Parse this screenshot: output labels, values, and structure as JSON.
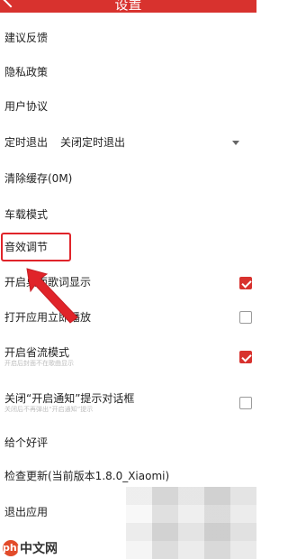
{
  "header": {
    "title": "设置"
  },
  "items": [
    {
      "label": "建议反馈"
    },
    {
      "label": "隐私政策"
    },
    {
      "label": "用户协议"
    },
    {
      "label": "定时退出",
      "value": "关闭定时退出"
    },
    {
      "label": "清除缓存(0M)"
    },
    {
      "label": "车载模式"
    },
    {
      "label": "音效调节"
    },
    {
      "label": "开启桌面歌词显示",
      "checked": true
    },
    {
      "label": "打开应用立即播放",
      "checked": false
    },
    {
      "label": "开启省流模式",
      "sublabel": "开启后封面不在歌曲显示",
      "checked": true
    },
    {
      "label": "关闭“开启通知”提示对话框",
      "sublabel": "关闭后不再弹出“开启通知”提示",
      "checked": false
    },
    {
      "label": "给个好评"
    },
    {
      "label": "检查更新(当前版本1.8.0_Xiaomi)"
    },
    {
      "label": "退出应用"
    }
  ],
  "watermark": {
    "logo": "php",
    "text": "中文网"
  },
  "colors": {
    "accent": "#d8322e",
    "annotation": "#e0242a"
  }
}
